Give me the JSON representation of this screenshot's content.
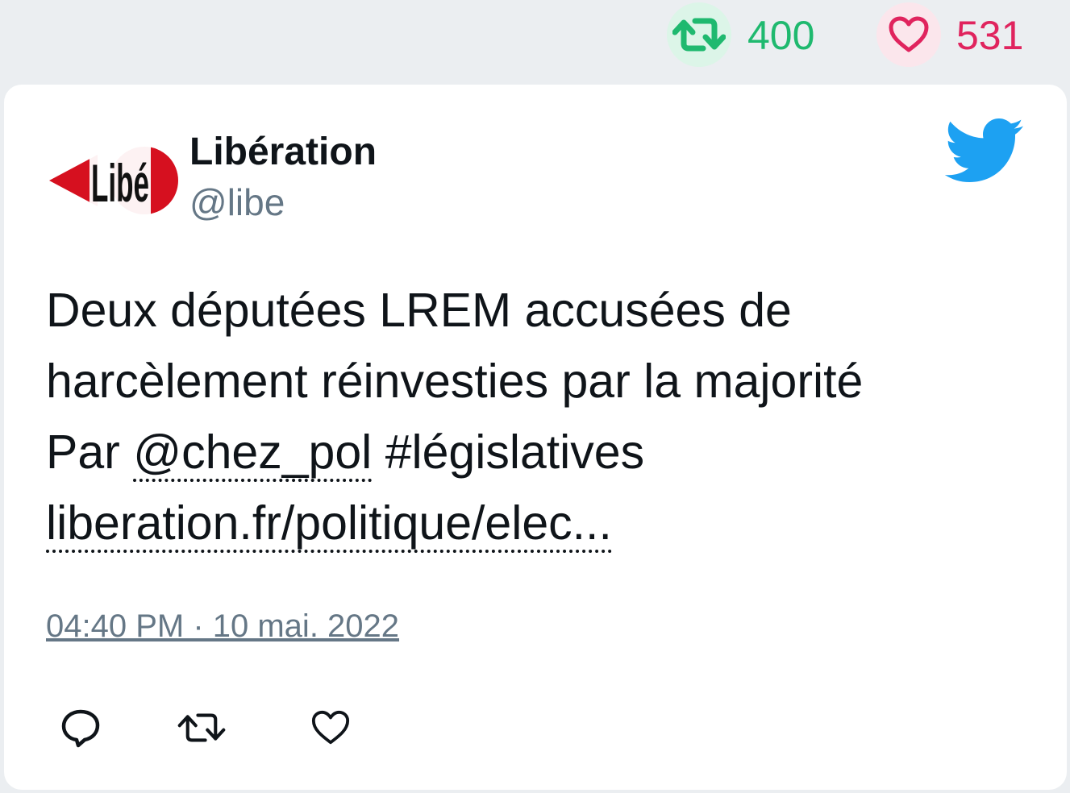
{
  "header_stats": {
    "retweets": "400",
    "likes": "531",
    "retweet_icon": "retweet-icon",
    "like_icon": "heart-icon",
    "retweet_color": "#1fb96f",
    "like_color": "#e0245e"
  },
  "tweet": {
    "author_name": "Libération",
    "author_handle": "@libe",
    "avatar_text": "Libé",
    "line1": "Deux députées LREM accusées de",
    "line2": "harcèlement réinvesties par la majorité",
    "line3_prefix": "Par ",
    "mention": "@chez_pol",
    "hashtag": "#législatives",
    "link": "liberation.fr/politique/elec...",
    "timestamp": "04:40 PM · 10 mai. 2022",
    "brand_icon": "twitter-bird-icon",
    "brand_color": "#1da1f2"
  },
  "actions": {
    "reply_icon": "reply-icon",
    "retweet_icon": "retweet-icon",
    "like_icon": "heart-icon"
  }
}
